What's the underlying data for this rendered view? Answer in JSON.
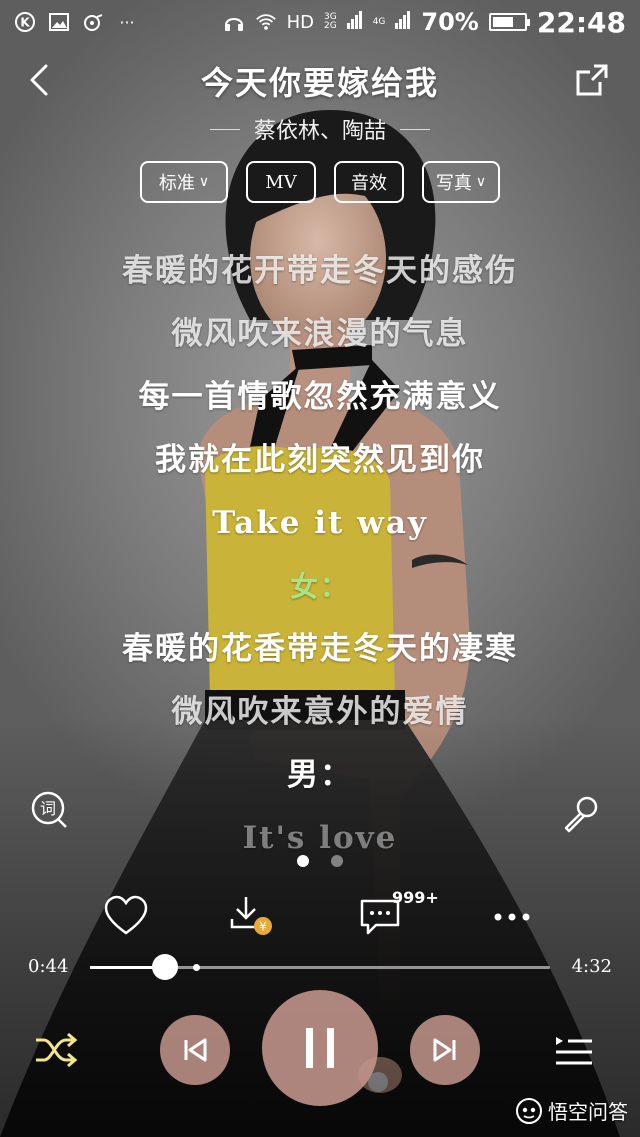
{
  "status_bar": {
    "network": "HD",
    "signal_labels": [
      "3G",
      "2G",
      "4G"
    ],
    "battery_text": "70%",
    "battery_level": 0.7,
    "time": "22:48"
  },
  "header": {
    "title": "今天你要嫁给我",
    "artist": "蔡依林、陶喆"
  },
  "modes": [
    {
      "label": "标准",
      "has_dropdown": true
    },
    {
      "label": "MV",
      "has_dropdown": false
    },
    {
      "label": "音效",
      "has_dropdown": false
    },
    {
      "label": "写真",
      "has_dropdown": true
    }
  ],
  "lyrics": [
    "春暖的花开带走冬天的感伤",
    "微风吹来浪漫的气息",
    "每一首情歌忽然充满意义",
    "我就在此刻突然见到你",
    "Take it way",
    "女：",
    "春暖的花香带走冬天的凄寒",
    "微风吹来意外的爱情",
    "男：",
    "It's love"
  ],
  "lyrics_icon_label": "词",
  "comment_count": "999+",
  "download_badge": "¥",
  "progress": {
    "current": "0:44",
    "total": "4:32",
    "played_fraction": 0.162,
    "buffered_fraction": 0.231
  },
  "pager": {
    "pages": 2,
    "active": 0
  },
  "watermark": "悟空问答",
  "colors": {
    "control_bg": "#c4968c",
    "lyric_label": "#a8e58a",
    "shuffle": "#f2e58a",
    "download_badge": "#e8a93a"
  }
}
